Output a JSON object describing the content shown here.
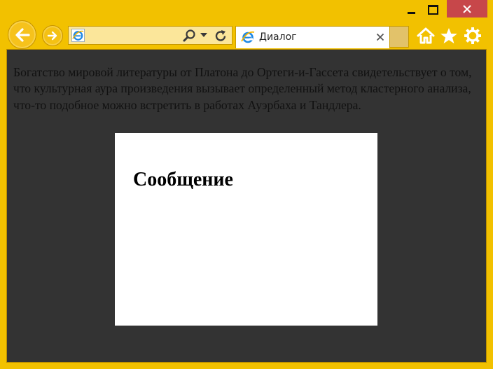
{
  "window": {
    "controls": {
      "minimize_icon": "minimize-icon",
      "maximize_icon": "maximize-icon",
      "close_icon": "close-icon",
      "close_color": "#c7474a"
    },
    "frame_color": "#f2c100"
  },
  "navigation": {
    "back_icon": "back-arrow-icon",
    "forward_icon": "forward-arrow-icon",
    "address": {
      "value": "",
      "site_icon": "internet-explorer-icon",
      "search_icon": "search-icon",
      "dropdown_icon": "chevron-down-icon",
      "refresh_icon": "refresh-icon"
    }
  },
  "tabs": [
    {
      "label": "Диалог",
      "icon": "internet-explorer-icon",
      "close_icon": "close-icon",
      "active": true
    }
  ],
  "toolbar": {
    "home_icon": "home-icon",
    "favorites_icon": "star-icon",
    "settings_icon": "gear-icon"
  },
  "page": {
    "background": "#333333",
    "text": "Богатство мировой литературы от Платона до Ортеги-и-Гассета свидетельствует о том, что культурная аура произведения вызывает определенный метод кластерного анализа, что-то подобное можно встретить в работах Ауэрбаха и Тандлера.",
    "dialog": {
      "title": "Сообщение",
      "background": "#ffffff"
    }
  }
}
